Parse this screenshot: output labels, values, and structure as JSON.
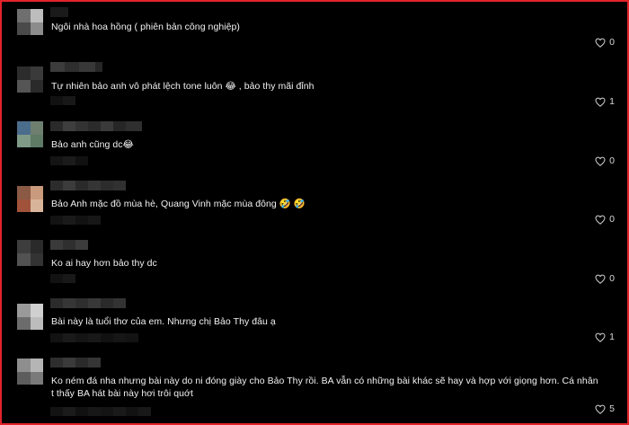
{
  "comments": [
    {
      "text": "Ngôi nhà hoa hồng ( phiên bản công nghiệp)",
      "emoji": 0,
      "likes": "0"
    },
    {
      "text": "Tự nhiên bảo anh vô phát lệch tone luôn 😂 , bảo thy mãi đỉnh",
      "emoji": 0,
      "likes": "1"
    },
    {
      "text": "Bảo anh cũng dc😂",
      "emoji": 0,
      "likes": "0"
    },
    {
      "text": "Bảo Anh mặc đồ mùa hè, Quang Vinh mặc mùa đông 🤣 🤣",
      "emoji": 0,
      "likes": "0"
    },
    {
      "text": "Ko ai hay hơn bảo thy dc",
      "emoji": 0,
      "likes": "0"
    },
    {
      "text": "Bài này là tuổi thơ của em. Nhưng chị Bảo Thy đâu ạ",
      "emoji": 0,
      "likes": "1"
    },
    {
      "text": "Ko ném đá nha nhưng bài này do ni đóng giày cho Bảo Thy rồi. BA vẫn có những bài khác sẽ hay và hợp với giọng hơn. Cá nhân t thấy BA hát bài này hơi trôi quớt",
      "emoji": 0,
      "likes": "5"
    }
  ],
  "icons": {
    "like": "heart-outline-icon"
  },
  "colors": {
    "border": "#e2232a",
    "background": "#000000",
    "text": "#f2f2f2"
  }
}
